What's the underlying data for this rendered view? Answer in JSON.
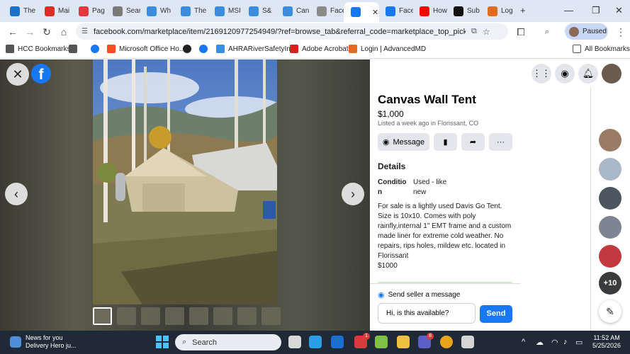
{
  "browser": {
    "tabs": [
      {
        "title": "The",
        "color": "#1a73c8"
      },
      {
        "title": "Mai",
        "color": "#d93025"
      },
      {
        "title": "Pag",
        "color": "#e0393e"
      },
      {
        "title": "Sear",
        "color": "#7a7a7a"
      },
      {
        "title": "Wh",
        "color": "#3b8de0"
      },
      {
        "title": "The",
        "color": "#3b8de0"
      },
      {
        "title": "MSI",
        "color": "#3b8de0"
      },
      {
        "title": "S&",
        "color": "#3b8de0"
      },
      {
        "title": "Can",
        "color": "#3b8de0"
      },
      {
        "title": "Face",
        "color": "#8a8a8a"
      },
      {
        "title": "",
        "color": "#1877f2",
        "active": true
      },
      {
        "title": "Face",
        "color": "#1877f2"
      },
      {
        "title": "How",
        "color": "#ff0000"
      },
      {
        "title": "Sub",
        "color": "#111111"
      },
      {
        "title": "Log",
        "color": "#e36b1f"
      }
    ],
    "new_tab": "+",
    "tab_close": "✕",
    "window_controls": {
      "minimize": "—",
      "restore": "❐",
      "close": "✕"
    },
    "url": "facebook.com/marketplace/item/2169120977254949/?ref=browse_tab&referral_code=marketplace_top_picks&referral_st...",
    "profile_status": "Paused",
    "menu": "⋮"
  },
  "bookmarks": [
    {
      "label": "HCC Bookmarks",
      "icon": "folder-icon",
      "color": "#555555"
    },
    {
      "label": "",
      "icon": "apps-grid-icon",
      "color": "#555555"
    },
    {
      "label": "",
      "icon": "facebook-icon",
      "color": "#1877f2"
    },
    {
      "label": "Microsoft Office Ho...",
      "icon": "microsoft-icon",
      "color": "#f25022"
    },
    {
      "label": "",
      "icon": "globe-icon",
      "color": "#222222"
    },
    {
      "label": "",
      "icon": "facebook-icon",
      "color": "#1877f2"
    },
    {
      "label": "AHRARiverSafetyInf...",
      "icon": "ahra-icon",
      "color": "#3b8de0"
    },
    {
      "label": "Adobe Acrobat",
      "icon": "acrobat-icon",
      "color": "#d4201f"
    },
    {
      "label": "Login | AdvancedMD",
      "icon": "advancedmd-icon",
      "color": "#e36b1f"
    }
  ],
  "all_bookmarks": "All Bookmarks",
  "listing": {
    "title": "Canvas Wall Tent",
    "price": "$1,000",
    "listed": "Listed a week ago in Florissant, CO",
    "message_label": "Message",
    "details_heading": "Details",
    "condition_label": "Condition",
    "condition_value": "Used - like new",
    "description": "For sale is a lightly used Davis Go Tent. Size is 10x10. Comes with poly rainfly,internal 1\" EMT frame and a custom made liner for extreme cold weather. No repairs, rips holes, mildew etc. located in Florissant\n$1000",
    "send_heading": "Send seller a message",
    "message_input": "Hi, is this available?",
    "send_label": "Send"
  },
  "viewer": {
    "close": "✕",
    "prev": "‹",
    "next": "›",
    "logo": "f",
    "thumbnail_count": 8,
    "selected_thumbnail": 1
  },
  "right_rail": {
    "more_contacts": "+10",
    "contact_colors": [
      "#9a7b66",
      "#aab7c6",
      "#4d5560",
      "#7c8591",
      "#c23a40"
    ]
  },
  "taskbar": {
    "news_title": "News for you",
    "news_sub": "Delivery Hero ju...",
    "search_placeholder": "Search",
    "badge_mail": "1",
    "badge_teams": "8",
    "time": "11:52 AM",
    "date": "5/25/2026",
    "tray_chevron": "^"
  }
}
